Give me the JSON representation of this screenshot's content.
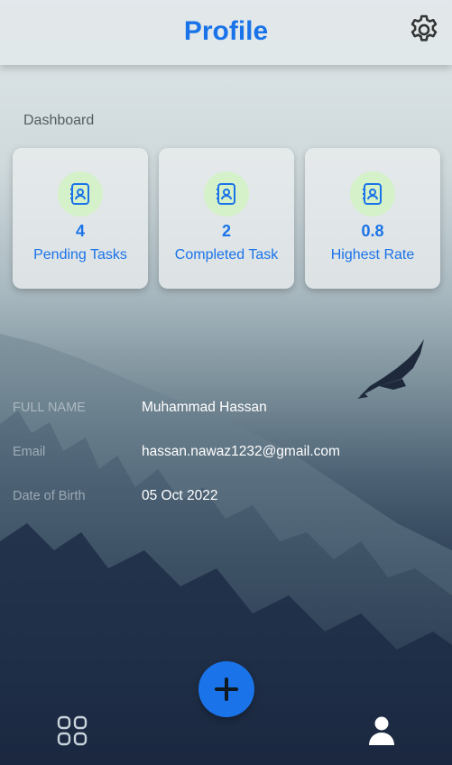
{
  "header": {
    "title": "Profile",
    "settings_icon": "gear-icon"
  },
  "dashboard": {
    "label": "Dashboard",
    "cards": [
      {
        "icon": "contact-book-icon",
        "value": "4",
        "label": "Pending Tasks"
      },
      {
        "icon": "contact-book-icon",
        "value": "2",
        "label": "Completed Task"
      },
      {
        "icon": "contact-book-icon",
        "value": "0.8",
        "label": "Highest Rate"
      }
    ]
  },
  "profile": {
    "rows": [
      {
        "label": "FULL NAME",
        "value": "Muhammad Hassan"
      },
      {
        "label": "Email",
        "value": "hassan.nawaz1232@gmail.com"
      },
      {
        "label": "Date of Birth",
        "value": "05 Oct 2022"
      }
    ]
  },
  "fab": {
    "icon": "plus-icon"
  },
  "bottom_nav": {
    "items": [
      {
        "icon": "grid-icon"
      },
      {
        "icon": "user-icon"
      }
    ]
  },
  "colors": {
    "accent": "#1a73e8",
    "icon_bg": "#d4f1c9"
  }
}
